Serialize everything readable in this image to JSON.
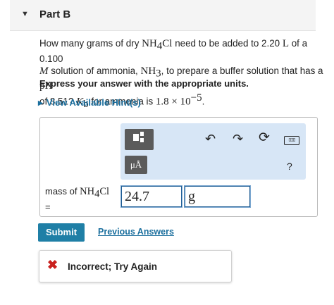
{
  "part": {
    "title": "Part B",
    "caret_icon": "triangle-down-icon"
  },
  "question": {
    "t1": "How many grams of dry ",
    "nh4cl_main": "NH",
    "nh4cl_sub": "4",
    "nh4cl_tail": "Cl",
    "t2": " need to be added to 2.20 ",
    "liter": "L",
    "t3": " of a 0.100",
    "molar": "M",
    "t4": " solution of ammonia, ",
    "nh3_main": "NH",
    "nh3_sub": "3",
    "t5": ", to prepare a buffer solution that has a ",
    "ph": "pH",
    "t6": " of 8.51? ",
    "kb_main": "K",
    "kb_sub": "b",
    "t7": " for ammonia is ",
    "kb_value": "1.8 × 10",
    "kb_exp": "−5",
    "t8": "."
  },
  "instruction": "Express your answer with the appropriate units.",
  "hints": {
    "label": "View Available Hint(s)",
    "icon": "triangle-right-icon"
  },
  "toolbar": {
    "templates_icon": "templates-icon",
    "units_label": "μÅ",
    "undo_icon": "undo-icon",
    "redo_icon": "redo-icon",
    "reset_icon": "reset-icon",
    "keyboard_icon": "keyboard-icon",
    "keyboard_glyph": "▯▯▯▯",
    "help_label": "?"
  },
  "answer": {
    "label_prefix": "mass of ",
    "label_main": "NH",
    "label_sub": "4",
    "label_tail": "Cl",
    "label_equals": "=",
    "value": "24.7",
    "unit": "g"
  },
  "submit_label": "Submit",
  "previous_answers_label": "Previous Answers",
  "feedback": {
    "icon": "x-icon",
    "text": "Incorrect; Try Again",
    "color": "#c9211e"
  },
  "colors": {
    "accent": "#1f7fa6",
    "link": "#1b6f9e",
    "toolbar_bg": "#d7e6f6"
  }
}
